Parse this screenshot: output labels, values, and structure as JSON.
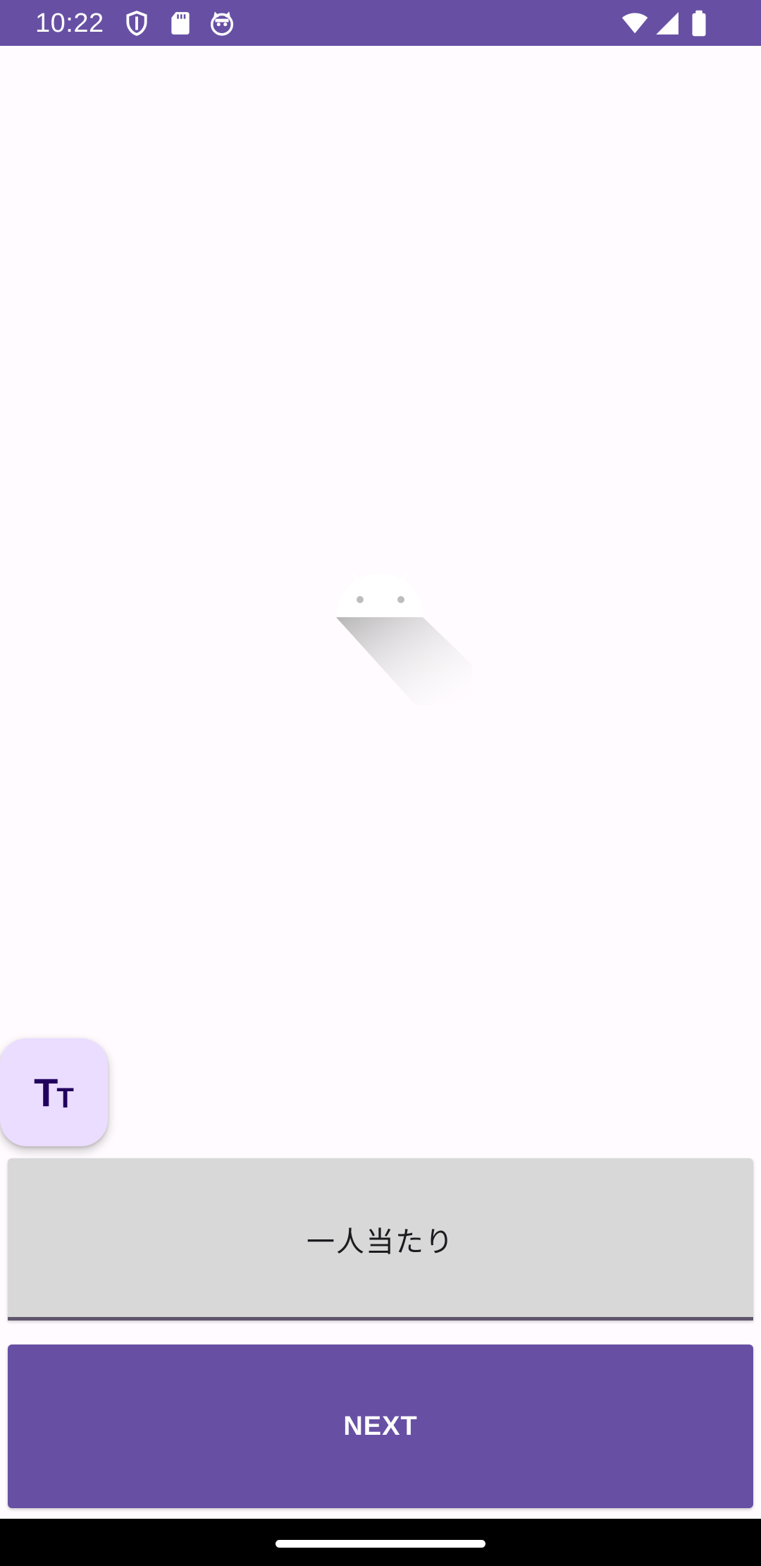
{
  "status_bar": {
    "time": "10:22",
    "left_icons": [
      "shield-icon",
      "sd-card-icon",
      "cat-face-icon"
    ],
    "right_icons": [
      "wifi-icon",
      "cell-signal-icon",
      "battery-icon"
    ],
    "background_color": "#6750A4"
  },
  "splash": {
    "icon": "android-icon"
  },
  "fab": {
    "icon": "text-size-icon",
    "icon_big": "T",
    "icon_small": "T",
    "background_color": "#EADDFF",
    "icon_color": "#21005D"
  },
  "text_field": {
    "value": "一人当たり",
    "background_color": "#D7D8D7"
  },
  "next_button": {
    "label": "NEXT",
    "background_color": "#6750A4"
  },
  "nav_bar": {
    "handle": "gesture-handle"
  }
}
